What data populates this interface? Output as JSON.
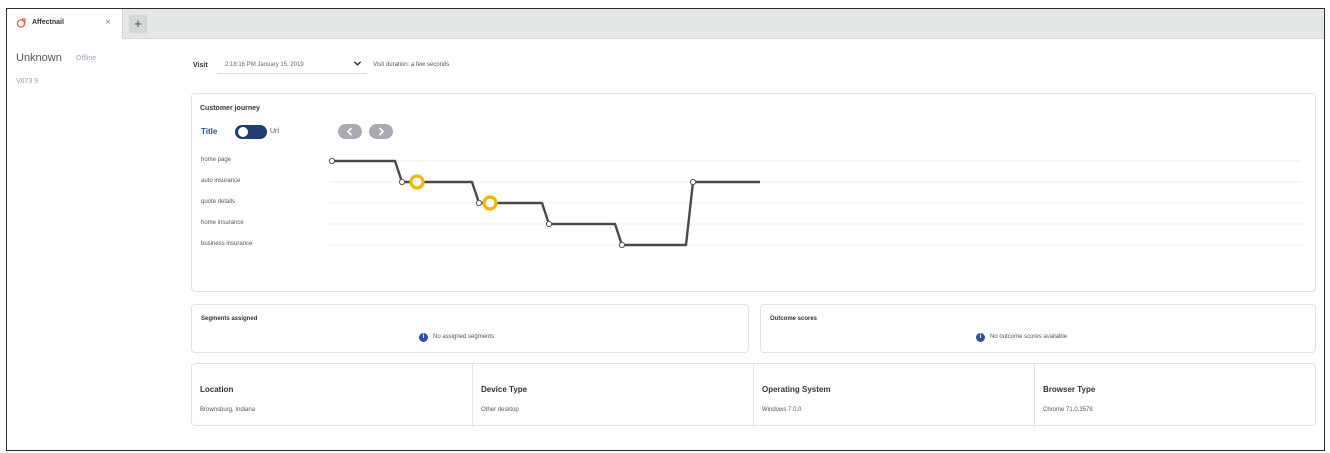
{
  "tab": {
    "title": "Affectnail",
    "close_label": "×",
    "new_tab_label": "+",
    "icon": "ab-test-logo-icon",
    "icon_color": "#e8543f"
  },
  "visitor": {
    "name": "Unknown",
    "status": "Offline",
    "visit_id": "V673 9"
  },
  "visit": {
    "label": "Visit",
    "selected": "2:18:16 PM January 15, 2019",
    "duration": "Visit duration: a few seconds"
  },
  "journey": {
    "title": "Customer journey",
    "toggle_left": "Title",
    "toggle_right": "Url",
    "toggle_on": true,
    "steps": [
      "home page",
      "auto insurance",
      "quote details",
      "home insurance",
      "business insurance"
    ],
    "path_line_color": "#4a4a4a",
    "highlight_color": "#f2b705"
  },
  "segments": {
    "title": "Segments assigned",
    "message": "No assigned segments"
  },
  "outcomes": {
    "title": "Outcome scores",
    "message": "No outcome scores available"
  },
  "details": [
    {
      "label": "Location",
      "value": "Brownsburg, Indiana"
    },
    {
      "label": "Device Type",
      "value": "Other desktop"
    },
    {
      "label": "Operating System",
      "value": "Windows 7.0.0"
    },
    {
      "label": "Browser Type",
      "value": "Chrome 71.0.3578"
    }
  ],
  "colors": {
    "accent": "#1f3d75",
    "info": "#2b51a8",
    "tabbar": "#e3e8e7"
  }
}
